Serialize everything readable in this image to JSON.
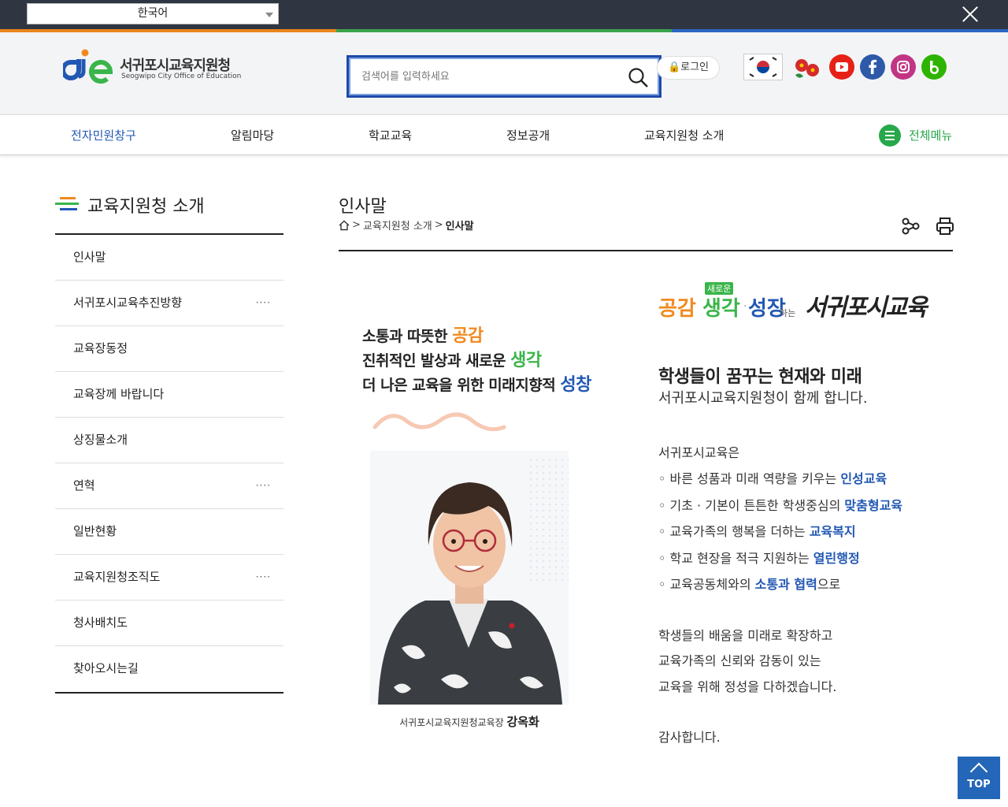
{
  "topbar": {
    "language": "한국어"
  },
  "colors": {
    "bar_orange": "#e9861c",
    "bar_green": "#3aa34a",
    "bar_blue": "#2b67c2",
    "accent_blue": "#2258b4",
    "accent_green": "#27a84a",
    "accent_orange": "#f08a1f"
  },
  "header": {
    "logo_ko": "서귀포시교육지원청",
    "logo_en": "Seogwipo City Office of Education",
    "search_placeholder": "검색어를 입력하세요",
    "login_label": "로그인",
    "social_icons": [
      "korea-flag-icon",
      "camellia-icon",
      "youtube-icon",
      "facebook-icon",
      "instagram-icon",
      "blog-icon"
    ]
  },
  "nav": {
    "items": [
      "전자민원창구",
      "알림마당",
      "학교교육",
      "정보공개",
      "교육지원청 소개"
    ],
    "all_menu": "전체메뉴"
  },
  "sidebar": {
    "title": "교육지원청 소개",
    "items": [
      {
        "label": "인사말",
        "dots": ""
      },
      {
        "label": "서귀포시교육추진방향",
        "dots": "····"
      },
      {
        "label": "교육장동정",
        "dots": ""
      },
      {
        "label": "교육장께 바랍니다",
        "dots": ""
      },
      {
        "label": "상징물소개",
        "dots": ""
      },
      {
        "label": "연혁",
        "dots": "····"
      },
      {
        "label": "일반현황",
        "dots": ""
      },
      {
        "label": "교육지원청조직도",
        "dots": "····"
      },
      {
        "label": "청사배치도",
        "dots": ""
      },
      {
        "label": "찾아오시는길",
        "dots": ""
      }
    ]
  },
  "content": {
    "title": "인사말",
    "breadcrumb": {
      "sep": ">",
      "parent": "교육지원청 소개",
      "current": "인사말"
    },
    "slogan": [
      {
        "text": "소통과 따뜻한 ",
        "key": "공감"
      },
      {
        "text": "진취적인 발상과 새로운 ",
        "key": "생각"
      },
      {
        "text": "더 나은 교육을 위한 미래지향적 ",
        "key": "성창"
      }
    ],
    "caption_org": "서귀포시교육지원청교육장",
    "caption_name": "강옥화",
    "motto": {
      "w1": "공감",
      "tag": "새로운",
      "w2": "생각",
      "w3": "성장",
      "suffix": "하는",
      "brand": "서귀포시교육"
    },
    "head": "학생들이 꿈꾸는 현재와 미래",
    "sub": "서귀포시교육지원청이 함께 합니다.",
    "intro": "서귀포시교육은",
    "bullets": [
      {
        "pre": "◦ 바른 성품과 미래 역량을 키우는 ",
        "hl": "인성교육",
        "post": ""
      },
      {
        "pre": "◦ 기초 · 기본이 튼튼한 학생중심의 ",
        "hl": "맞춤형교육",
        "post": ""
      },
      {
        "pre": "◦ 교육가족의 행복을 더하는 ",
        "hl": "교육복지",
        "post": ""
      },
      {
        "pre": "◦ 학교 현장을 적극 지원하는 ",
        "hl": "열린행정",
        "post": ""
      },
      {
        "pre": "◦ 교육공동체와의 ",
        "hl": "소통과 협력",
        "post": "으로"
      }
    ],
    "closing": [
      "학생들의 배움을 미래로 확장하고",
      "교육가족의 신뢰와 감동이 있는",
      "교육을 위해 정성을 다하겠습니다."
    ],
    "thanks": "감사합니다."
  },
  "top_button": "TOP"
}
